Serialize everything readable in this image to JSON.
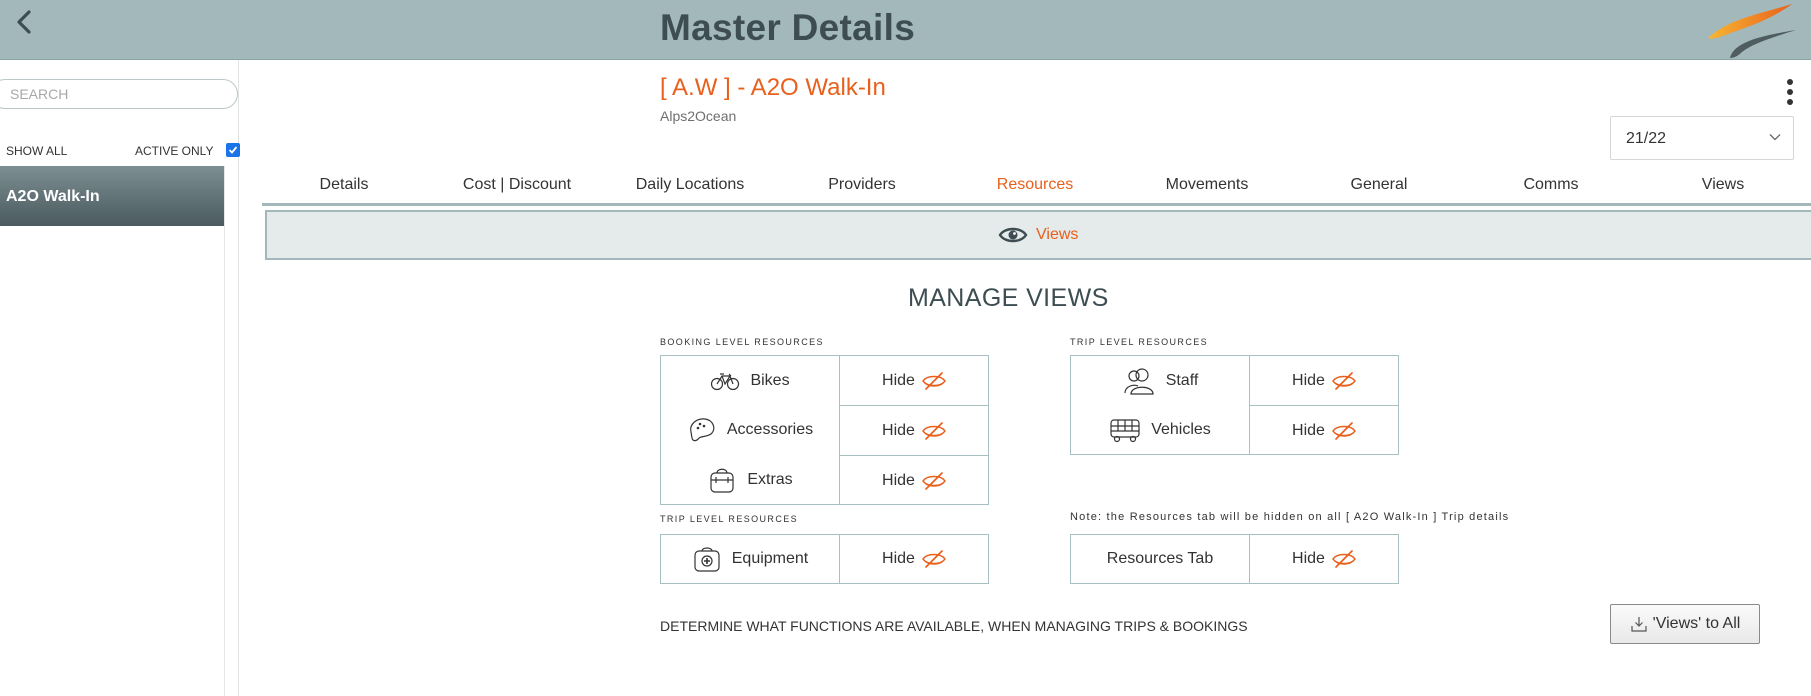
{
  "header": {
    "title": "Master Details",
    "back_icon": "chevron-left-icon",
    "colors": {
      "bar": "#a2b8bb",
      "title": "#3d4d52",
      "accent": "#e8601c"
    }
  },
  "sidebar": {
    "search_placeholder": "SEARCH",
    "show_all": "SHOW ALL",
    "active_only": "ACTIVE ONLY",
    "active_only_checked": true,
    "items": [
      {
        "label": "A2O Walk-In",
        "selected": true
      }
    ]
  },
  "trip": {
    "title": "[ A.W ] - A2O Walk-In",
    "subtitle": "Alps2Ocean",
    "season": "21/22"
  },
  "tabs": [
    {
      "label": "Details"
    },
    {
      "label": "Cost | Discount"
    },
    {
      "label": "Daily Locations"
    },
    {
      "label": "Providers"
    },
    {
      "label": "Resources",
      "active": true
    },
    {
      "label": "Movements"
    },
    {
      "label": "General"
    },
    {
      "label": "Comms"
    },
    {
      "label": "Views"
    }
  ],
  "views_bar": {
    "label": "Views",
    "icon": "eye-icon"
  },
  "manage": {
    "title": "MANAGE VIEWS",
    "booking_level": {
      "label": "BOOKING LEVEL RESOURCES",
      "rows": [
        {
          "name": "Bikes",
          "icon": "bike-icon",
          "action": "Hide"
        },
        {
          "name": "Accessories",
          "icon": "helmet-icon",
          "action": "Hide"
        },
        {
          "name": "Extras",
          "icon": "bag-icon",
          "action": "Hide"
        }
      ]
    },
    "trip_level_left": {
      "label": "TRIP LEVEL RESOURCES",
      "rows": [
        {
          "name": "Equipment",
          "icon": "first-aid-icon",
          "action": "Hide"
        }
      ]
    },
    "trip_level_right": {
      "label": "TRIP LEVEL RESOURCES",
      "rows": [
        {
          "name": "Staff",
          "icon": "users-icon",
          "action": "Hide"
        },
        {
          "name": "Vehicles",
          "icon": "bus-icon",
          "action": "Hide"
        }
      ]
    },
    "note": "Note: the Resources tab will be hidden on all [ A2O Walk-In ] Trip details",
    "resources_tab": {
      "name": "Resources Tab",
      "action": "Hide"
    },
    "footer": "DETERMINE WHAT FUNCTIONS ARE AVAILABLE, WHEN MANAGING TRIPS & BOOKINGS",
    "apply_button": "'Views' to All"
  }
}
